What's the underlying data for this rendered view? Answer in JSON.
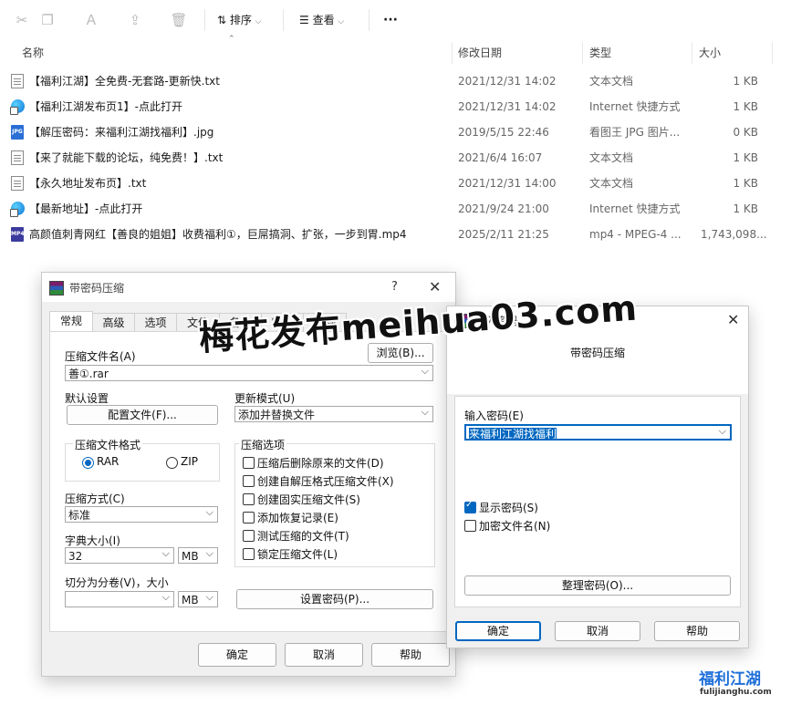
{
  "toolbar": {
    "sort_label": "排序",
    "view_label": "查看",
    "more_label": "···"
  },
  "columns": {
    "name": "名称",
    "date": "修改日期",
    "type": "类型",
    "size": "大小"
  },
  "files": [
    {
      "name": "【福利江湖】全免费-无套路-更新快.txt",
      "date": "2021/12/31 14:02",
      "type": "文本文档",
      "size": "1 KB",
      "icon": "txt"
    },
    {
      "name": "【福利江湖发布页1】-点此打开",
      "date": "2021/12/31 14:02",
      "type": "Internet 快捷方式",
      "size": "1 KB",
      "icon": "url"
    },
    {
      "name": "【解压密码：来福利江湖找福利】.jpg",
      "date": "2019/5/15 22:46",
      "type": "看图王 JPG 图片...",
      "size": "0 KB",
      "icon": "jpg"
    },
    {
      "name": "【来了就能下载的论坛，纯免费！】.txt",
      "date": "2021/6/4 16:07",
      "type": "文本文档",
      "size": "1 KB",
      "icon": "txt"
    },
    {
      "name": "【永久地址发布页】.txt",
      "date": "2021/12/31 14:00",
      "type": "文本文档",
      "size": "1 KB",
      "icon": "txt"
    },
    {
      "name": "【最新地址】-点此打开",
      "date": "2021/9/24 21:00",
      "type": "Internet 快捷方式",
      "size": "1 KB",
      "icon": "url"
    },
    {
      "name": "高颜值刺青网红【善良的姐姐】收费福利①，巨屌搞洞、扩张，一步到胃.mp4",
      "date": "2025/2/11 21:25",
      "type": "mp4 - MPEG-4 ...",
      "size": "1,743,098...",
      "icon": "mp4"
    }
  ],
  "archive_dialog": {
    "title": "带密码压缩",
    "help_glyph": "?",
    "tabs": [
      "常规",
      "高级",
      "选项",
      "文件",
      "备份",
      "时间",
      "注释"
    ],
    "archive_name_label": "压缩文件名(A)",
    "browse_label": "浏览(B)...",
    "archive_name_value": "善①.rar",
    "default_settings_label": "默认设置",
    "profiles_label": "配置文件(F)...",
    "update_mode_label": "更新模式(U)",
    "update_mode_value": "添加并替换文件",
    "format_group_label": "压缩文件格式",
    "format_rar": "RAR",
    "format_zip": "ZIP",
    "options_group_label": "压缩选项",
    "options": [
      "压缩后删除原来的文件(D)",
      "创建自解压格式压缩文件(X)",
      "创建固实压缩文件(S)",
      "添加恢复记录(E)",
      "测试压缩的文件(T)",
      "锁定压缩文件(L)"
    ],
    "method_label": "压缩方式(C)",
    "method_value": "标准",
    "dict_label": "字典大小(I)",
    "dict_value": "32",
    "dict_unit": "MB",
    "split_label": "切分为分卷(V)，大小",
    "split_value": "",
    "split_unit": "MB",
    "set_password_label": "设置密码(P)...",
    "ok_label": "确定",
    "cancel_label": "取消",
    "help_label": "帮助"
  },
  "password_dialog": {
    "title": "输入密码",
    "subtitle": "带密码压缩",
    "enter_label": "输入密码(E)",
    "password_value": "来福利江湖找福利",
    "show_password_label": "显示密码(S)",
    "encrypt_names_label": "加密文件名(N)",
    "organize_label": "整理密码(O)...",
    "ok_label": "确定",
    "cancel_label": "取消",
    "help_label": "帮助"
  },
  "watermark": {
    "text": "梅花发布meihua03.com",
    "logo_text": "福利江湖",
    "logo_domain": "fulijianghu.com"
  }
}
